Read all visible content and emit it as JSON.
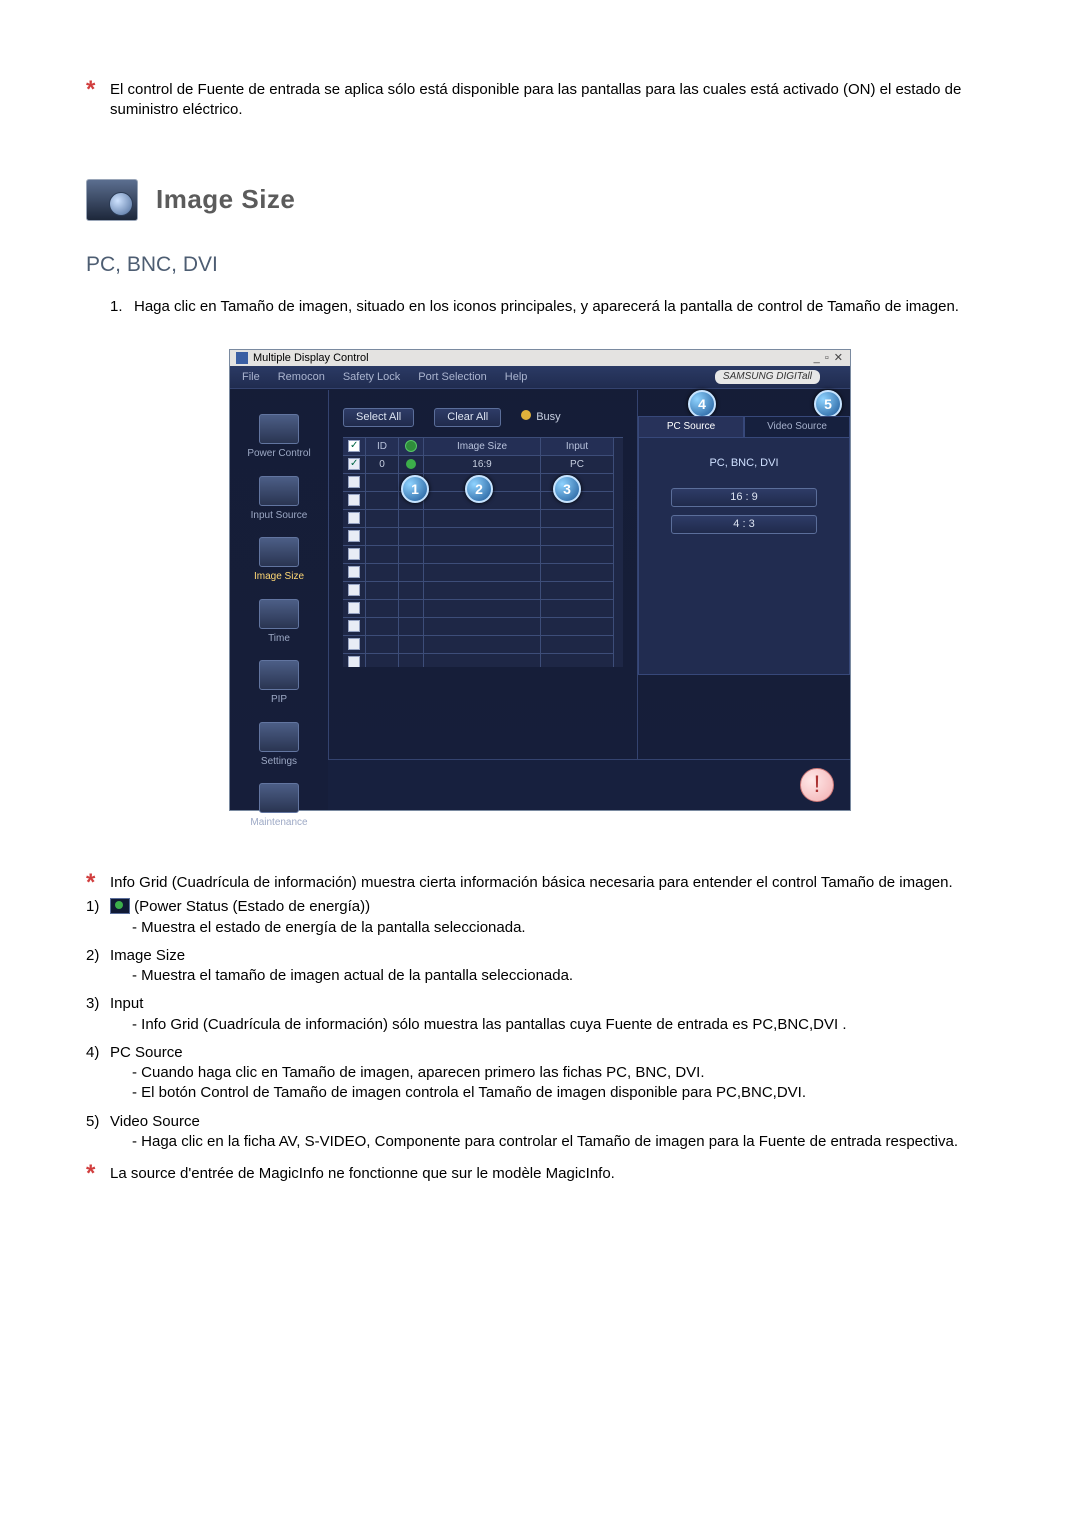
{
  "note_top": "El control de Fuente de entrada se aplica sólo está disponible para las pantallas para las cuales está activado (ON) el estado de suministro eléctrico.",
  "section_title": "Image Size",
  "subheading": "PC, BNC, DVI",
  "step1": "Haga clic en Tamaño de imagen, situado en los iconos principales, y aparecerá la pantalla de control de Tamaño de imagen.",
  "app": {
    "window_title": "Multiple Display Control",
    "brand": "SAMSUNG DIGITall",
    "menubar": [
      "File",
      "Remocon",
      "Safety Lock",
      "Port Selection",
      "Help"
    ],
    "sidebar": [
      {
        "label": "Power Control"
      },
      {
        "label": "Input Source"
      },
      {
        "label": "Image Size",
        "active": true
      },
      {
        "label": "Time"
      },
      {
        "label": "PIP"
      },
      {
        "label": "Settings"
      },
      {
        "label": "Maintenance"
      }
    ],
    "buttons": {
      "select_all": "Select All",
      "clear_all": "Clear All",
      "busy": "Busy"
    },
    "grid_headers": {
      "id": "ID",
      "image": "Image Size",
      "input": "Input"
    },
    "grid_rows": [
      {
        "id": "0",
        "image": "16:9",
        "input": "PC",
        "checked": true,
        "on": true
      }
    ],
    "tabs": {
      "pc": "PC Source",
      "video": "Video Source"
    },
    "right": {
      "group": "PC, BNC, DVI",
      "opt1": "16 : 9",
      "opt2": "4 : 3"
    }
  },
  "info_note": "Info Grid (Cuadrícula de información) muestra cierta información básica necesaria para entender el control Tamaño de imagen.",
  "items": {
    "i1_label": " (Power Status (Estado de energía))",
    "i1_sub": "- Muestra el estado de energía de la pantalla seleccionada.",
    "i2_label": "Image Size",
    "i2_sub": "- Muestra el tamaño de imagen actual de la pantalla seleccionada.",
    "i3_label": "Input",
    "i3_sub": "- Info Grid (Cuadrícula de información) sólo muestra las pantallas cuya Fuente de entrada es PC,BNC,DVI .",
    "i4_label": "PC Source",
    "i4_sub_a": "- Cuando haga clic en Tamaño de imagen, aparecen primero las fichas PC, BNC, DVI.",
    "i4_sub_b": "- El botón Control de Tamaño de imagen controla el Tamaño de imagen disponible para PC,BNC,DVI.",
    "i5_label": "Video Source",
    "i5_sub": "- Haga clic en la ficha AV, S-VIDEO, Componente para controlar el Tamaño de imagen para la Fuente de entrada respectiva."
  },
  "bottom_note": "La source d'entrée de MagicInfo ne fonctionne que sur le modèle MagicInfo.",
  "callouts": {
    "c1": "1",
    "c2": "2",
    "c3": "3",
    "c4": "4",
    "c5": "5"
  },
  "list_numbers": {
    "n1": "1)",
    "n2": "2)",
    "n3": "3)",
    "n4": "4)",
    "n5": "5)",
    "step1": "1."
  }
}
